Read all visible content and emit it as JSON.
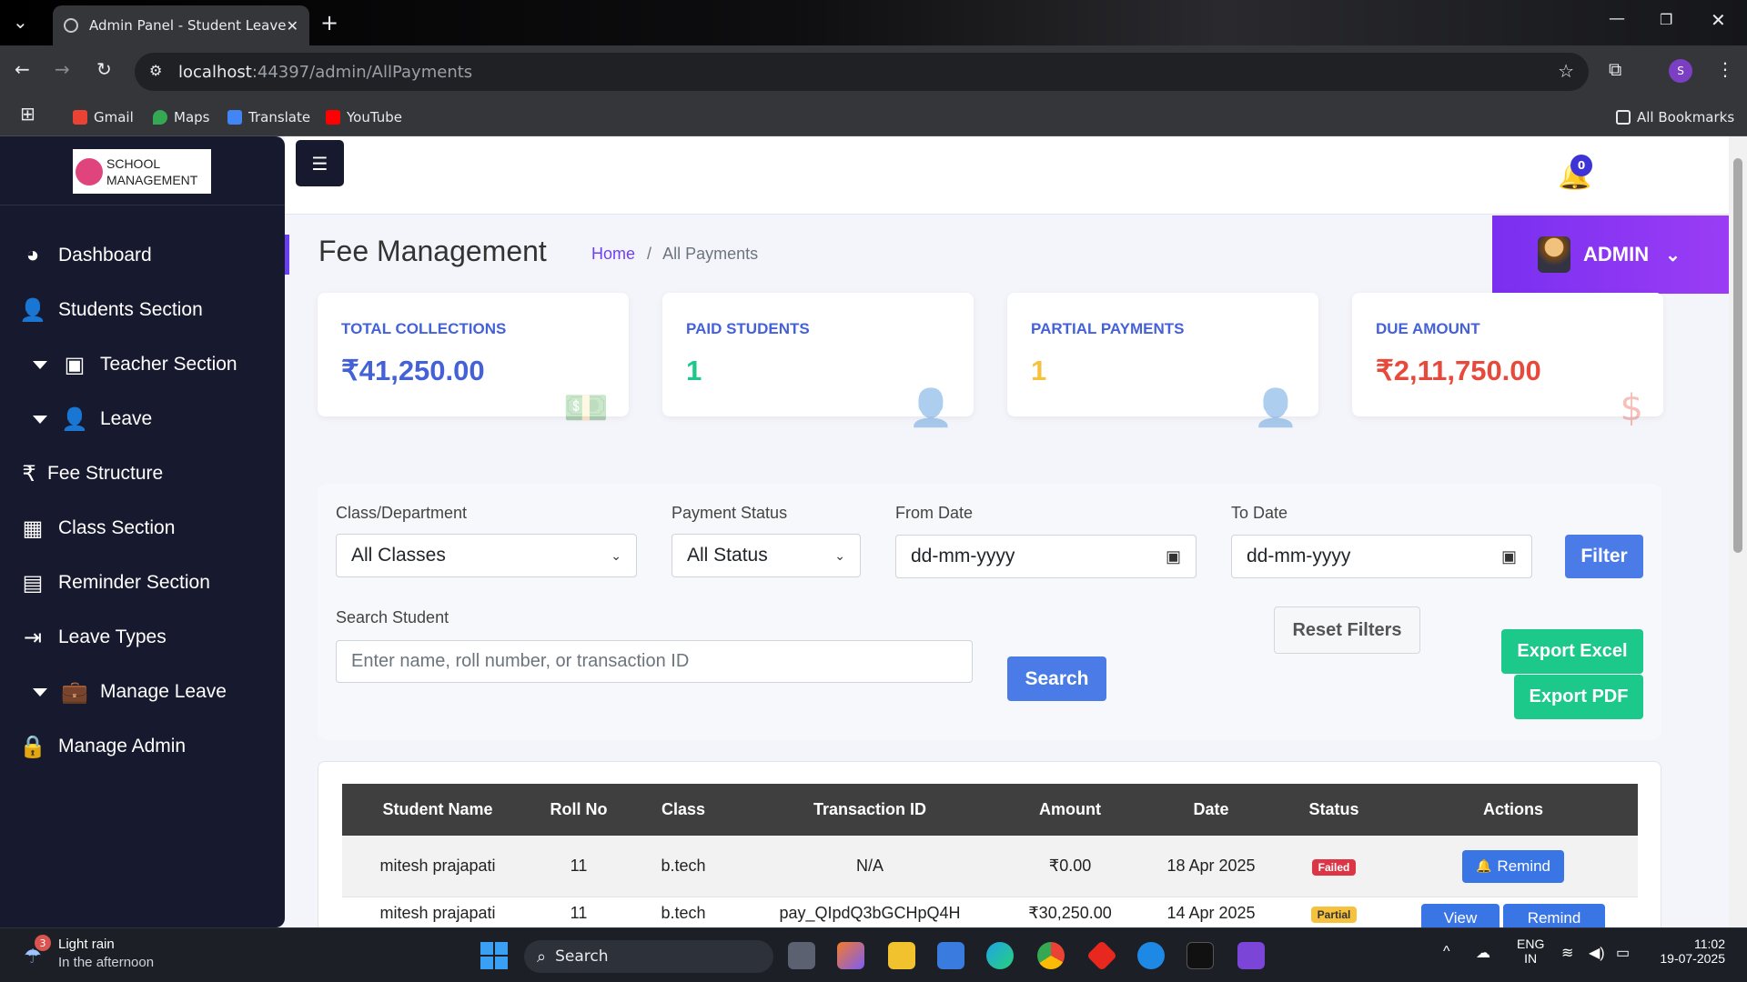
{
  "browser": {
    "tab_title": "Admin Panel - Student Leave",
    "url_host": "localhost",
    "url_path": ":44397/admin/AllPayments",
    "profile_initial": "S",
    "bookmarks": [
      "Gmail",
      "Maps",
      "Translate",
      "YouTube"
    ],
    "all_bookmarks": "All Bookmarks"
  },
  "sidebar": {
    "logo_line1": "SCHOOL",
    "logo_line2": "MANAGEMENT",
    "items": [
      {
        "label": "Dashboard",
        "icon": "dashboard-icon"
      },
      {
        "label": "Students Section",
        "icon": "user-icon"
      },
      {
        "label": "Teacher Section",
        "icon": "teacher-icon"
      },
      {
        "label": "Leave",
        "icon": "user-icon"
      },
      {
        "label": "Fee Structure",
        "icon": "rupee-icon"
      },
      {
        "label": "Class Section",
        "icon": "grid-icon"
      },
      {
        "label": "Reminder Section",
        "icon": "calendar-icon"
      },
      {
        "label": "Leave Types",
        "icon": "signout-icon"
      },
      {
        "label": "Manage Leave",
        "icon": "briefcase-icon"
      },
      {
        "label": "Manage Admin",
        "icon": "lock-icon"
      }
    ]
  },
  "header": {
    "menu_icon": "hamburger-icon",
    "notif_count": "0",
    "admin_label": "ADMIN",
    "title": "Fee Management",
    "breadcrumb_home": "Home",
    "breadcrumb_sep": "/",
    "breadcrumb_current": "All Payments"
  },
  "cards": [
    {
      "label": "TOTAL COLLECTIONS",
      "value": "₹41,250.00",
      "color": "#4461d8",
      "icon": "money-icon"
    },
    {
      "label": "PAID STUDENTS",
      "value": "1",
      "color": "#1cc88a",
      "icon": "user-check-icon"
    },
    {
      "label": "PARTIAL PAYMENTS",
      "value": "1",
      "color": "#f6c23e",
      "icon": "user-clock-icon"
    },
    {
      "label": "DUE AMOUNT",
      "value": "₹2,11,750.00",
      "color": "#e74a3b",
      "icon": "hand-dollar-icon"
    }
  ],
  "filters": {
    "class_label": "Class/Department",
    "class_value": "All Classes",
    "status_label": "Payment Status",
    "status_value": "All Status",
    "from_label": "From Date",
    "from_placeholder": "dd-mm-yyyy",
    "to_label": "To Date",
    "to_placeholder": "dd-mm-yyyy",
    "filter_button": "Filter",
    "search_label": "Search Student",
    "search_placeholder": "Enter name, roll number, or transaction ID",
    "search_button": "Search",
    "reset_button": "Reset Filters",
    "export_excel": "Export Excel",
    "export_pdf": "Export PDF"
  },
  "table": {
    "headers": [
      "Student Name",
      "Roll No",
      "Class",
      "Transaction ID",
      "Amount",
      "Date",
      "Status",
      "Actions"
    ],
    "rows": [
      {
        "name": "mitesh prajapati",
        "roll": "11",
        "class": "b.tech",
        "txn": "N/A",
        "amount": "₹0.00",
        "date": "18 Apr 2025",
        "status": "Failed",
        "action1": "Remind"
      },
      {
        "name": "mitesh prajapati",
        "roll": "11",
        "class": "b.tech",
        "txn": "pay_QIpdQ3bGCHpQ4H",
        "amount": "₹30,250.00",
        "date": "14 Apr 2025",
        "status": "Partial",
        "action1": "View",
        "action2": "Remind"
      }
    ]
  },
  "taskbar": {
    "weather_title": "Light rain",
    "weather_sub": "In the afternoon",
    "weather_badge": "3",
    "search": "Search",
    "lang1": "ENG",
    "lang2": "IN",
    "time": "11:02",
    "date": "19-07-2025"
  }
}
